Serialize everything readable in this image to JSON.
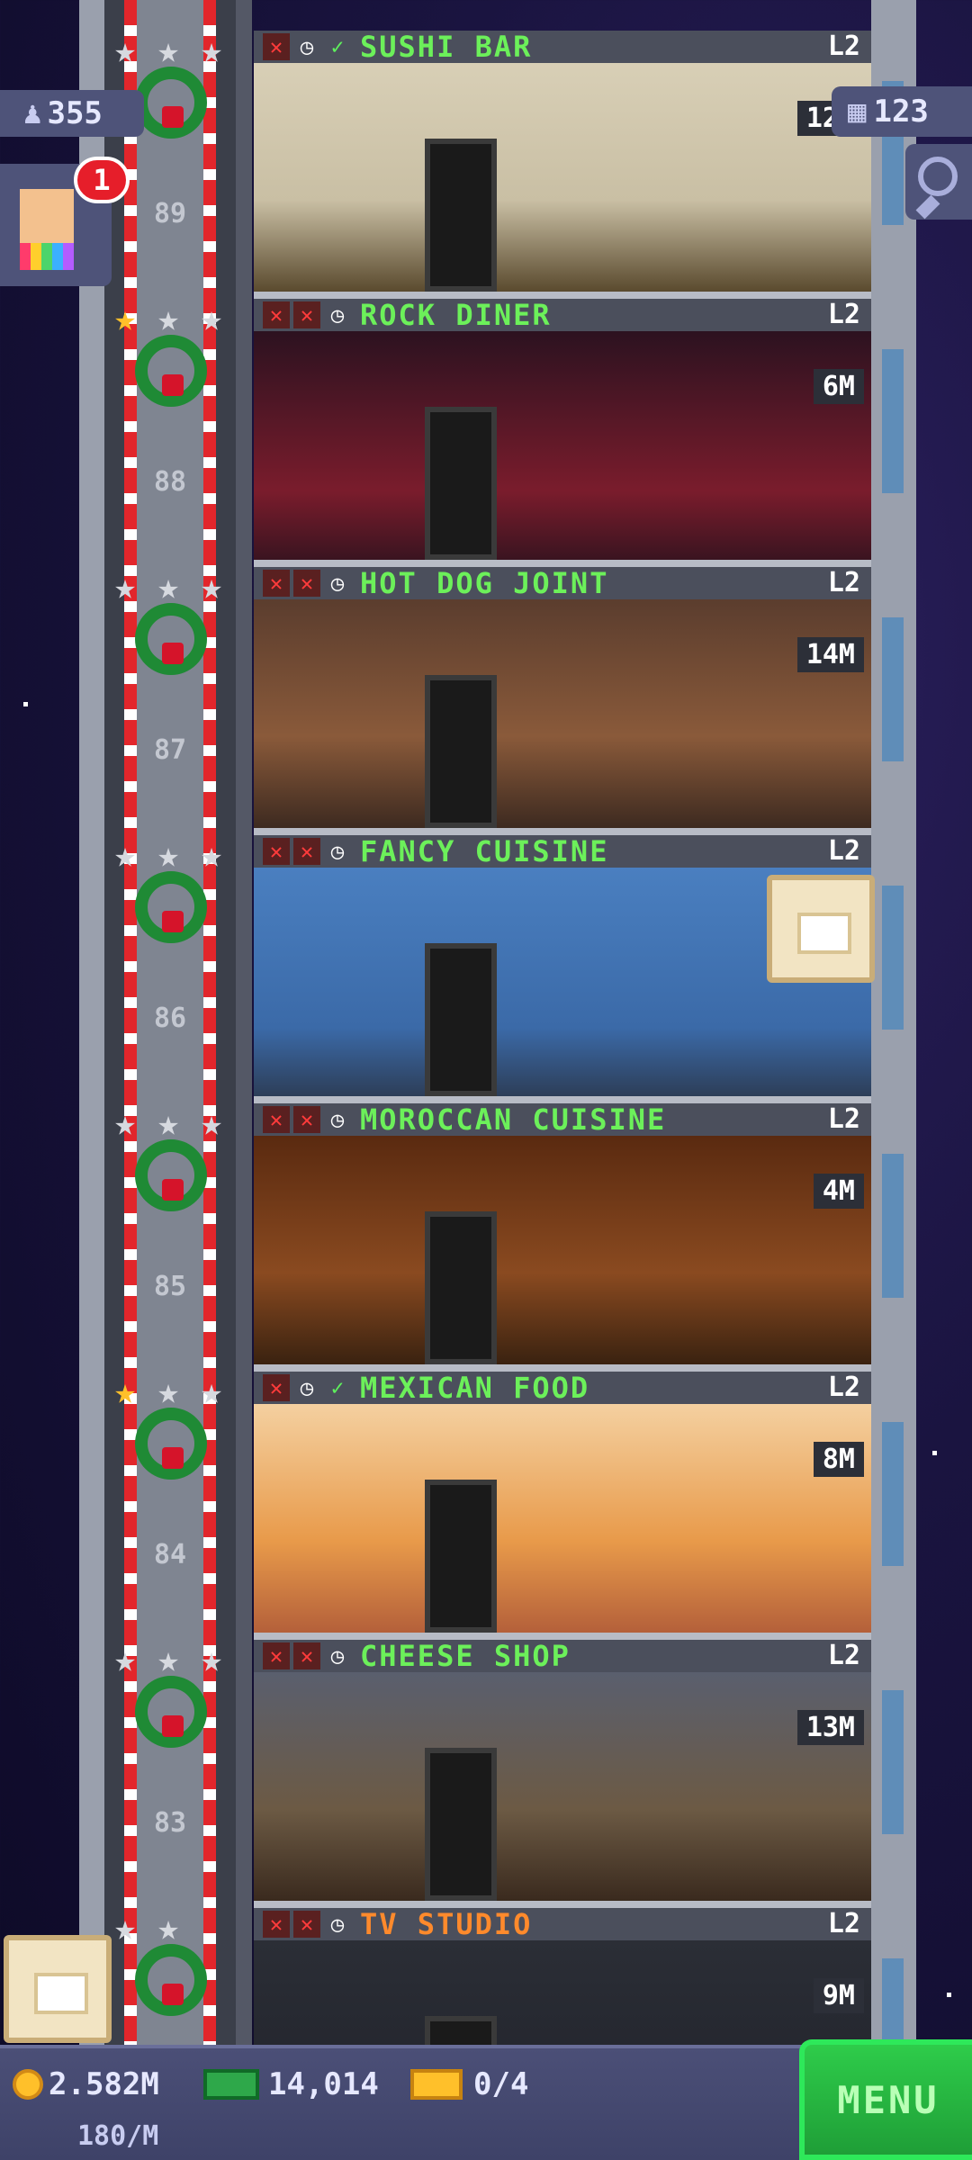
{
  "hud": {
    "population": "355",
    "notification_count": "1",
    "floor_count": "123"
  },
  "floors": [
    {
      "name": "SUSHI BAR",
      "level": "L2",
      "income": "12M",
      "floor_num": "89",
      "stars": [
        "silver",
        "silver",
        "silver"
      ],
      "status": [
        "x",
        "clock",
        "check"
      ],
      "color": "green"
    },
    {
      "name": "ROCK DINER",
      "level": "L2",
      "income": "6M",
      "floor_num": "88",
      "stars": [
        "gold",
        "silver",
        "silver"
      ],
      "status": [
        "x",
        "x",
        "clock"
      ],
      "color": "green"
    },
    {
      "name": "HOT DOG JOINT",
      "level": "L2",
      "income": "14M",
      "floor_num": "87",
      "stars": [
        "silver",
        "silver",
        "silver"
      ],
      "status": [
        "x",
        "x",
        "clock"
      ],
      "color": "green"
    },
    {
      "name": "FANCY CUISINE",
      "level": "L2",
      "income": "",
      "floor_num": "86",
      "stars": [
        "silver",
        "silver",
        "silver"
      ],
      "status": [
        "x",
        "x",
        "clock"
      ],
      "color": "green"
    },
    {
      "name": "MOROCCAN CUISINE",
      "level": "L2",
      "income": "4M",
      "floor_num": "85",
      "stars": [
        "silver",
        "silver",
        "silver"
      ],
      "status": [
        "x",
        "x",
        "clock"
      ],
      "color": "green"
    },
    {
      "name": "MEXICAN FOOD",
      "level": "L2",
      "income": "8M",
      "floor_num": "84",
      "stars": [
        "gold",
        "silver",
        "silver"
      ],
      "status": [
        "x",
        "clock",
        "check"
      ],
      "color": "green"
    },
    {
      "name": "CHEESE SHOP",
      "level": "L2",
      "income": "13M",
      "floor_num": "83",
      "stars": [
        "silver",
        "silver",
        "silver"
      ],
      "status": [
        "x",
        "x",
        "clock"
      ],
      "color": "green"
    },
    {
      "name": "TV STUDIO",
      "level": "L2",
      "income": "9M",
      "floor_num": "",
      "stars": [
        "silver",
        "silver"
      ],
      "status": [
        "x",
        "x",
        "clock"
      ],
      "color": "orange"
    }
  ],
  "bottom_bar": {
    "coins": "2.582M",
    "coin_rate": "180/M",
    "bux": "14,014",
    "tickets": "0/4",
    "menu_label": "MENU"
  },
  "icons": {
    "population": "person-icon",
    "floors": "building-icon",
    "zoom": "magnifier-icon",
    "crate": "crate-icon"
  },
  "colors": {
    "floor_name_green": "#6cf05a",
    "floor_name_orange": "#ff8a2c",
    "menu_green": "#2ecc4a",
    "coin_gold": "#ffc02a"
  }
}
